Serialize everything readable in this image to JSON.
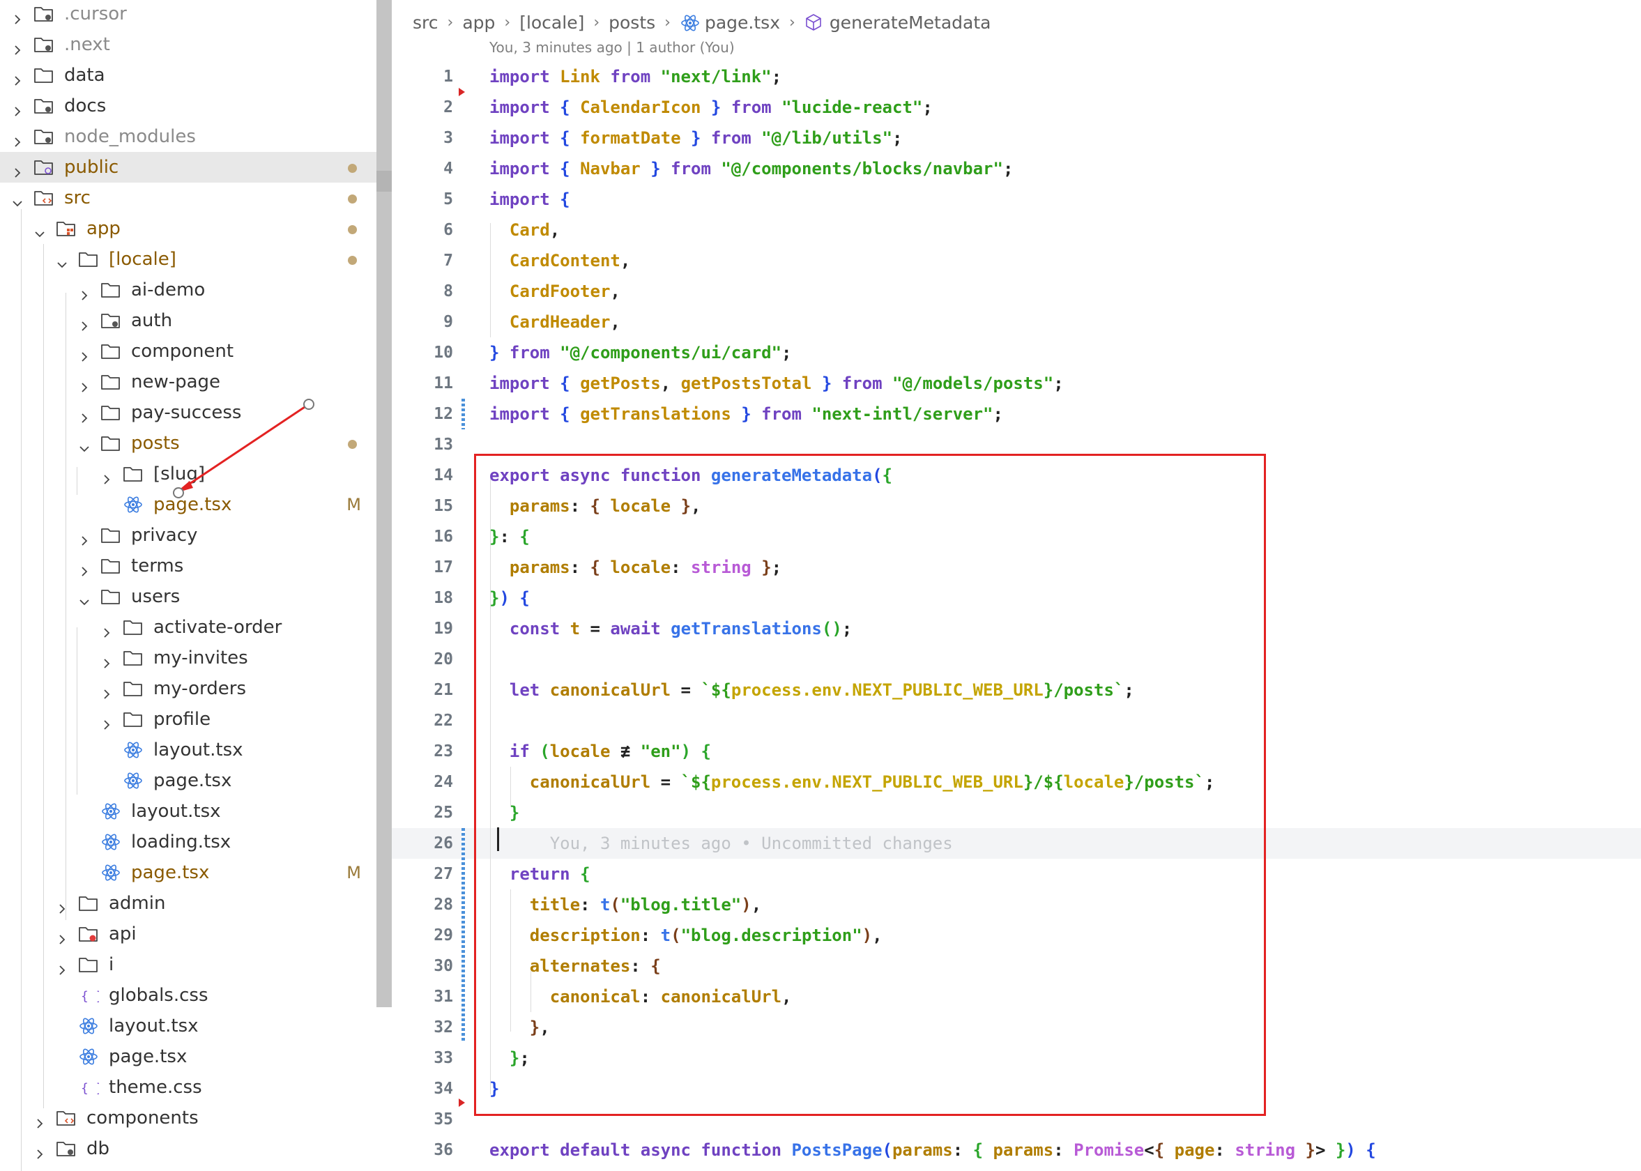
{
  "explorer": {
    "items": [
      {
        "label": "cursor_dir",
        "text": ".cursor",
        "muted": true,
        "depth": 0,
        "expanded": false,
        "type": "folder-special"
      },
      {
        "text": ".next",
        "muted": true,
        "depth": 0,
        "expanded": false,
        "type": "folder-special"
      },
      {
        "text": "data",
        "depth": 0,
        "expanded": false,
        "type": "folder"
      },
      {
        "text": "docs",
        "depth": 0,
        "expanded": false,
        "type": "folder-special"
      },
      {
        "text": "node_modules",
        "muted": true,
        "depth": 0,
        "expanded": false,
        "type": "folder-special"
      },
      {
        "text": "public",
        "depth": 0,
        "expanded": false,
        "type": "folder-public",
        "selected": true,
        "dot": true,
        "color": "#8a5a00"
      },
      {
        "text": "src",
        "depth": 0,
        "expanded": true,
        "type": "folder-src",
        "dot": true,
        "color": "#8a5a00"
      },
      {
        "text": "app",
        "depth": 1,
        "expanded": true,
        "type": "folder-app",
        "dot": true,
        "color": "#8a5a00"
      },
      {
        "text": "[locale]",
        "depth": 2,
        "expanded": true,
        "type": "folder",
        "dot": true,
        "color": "#8a5a00"
      },
      {
        "text": "ai-demo",
        "depth": 3,
        "expanded": false,
        "type": "folder"
      },
      {
        "text": "auth",
        "depth": 3,
        "expanded": false,
        "type": "folder-special"
      },
      {
        "text": "component",
        "depth": 3,
        "expanded": false,
        "type": "folder"
      },
      {
        "text": "new-page",
        "depth": 3,
        "expanded": false,
        "type": "folder"
      },
      {
        "text": "pay-success",
        "depth": 3,
        "expanded": false,
        "type": "folder"
      },
      {
        "text": "posts",
        "depth": 3,
        "expanded": true,
        "type": "folder",
        "dot": true,
        "color": "#8a5a00"
      },
      {
        "text": "[slug]",
        "depth": 4,
        "expanded": false,
        "type": "folder"
      },
      {
        "text": "page.tsx",
        "depth": 4,
        "type": "react",
        "status": "M",
        "color": "#8a5a00"
      },
      {
        "text": "privacy",
        "depth": 3,
        "expanded": false,
        "type": "folder"
      },
      {
        "text": "terms",
        "depth": 3,
        "expanded": false,
        "type": "folder"
      },
      {
        "text": "users",
        "depth": 3,
        "expanded": true,
        "type": "folder"
      },
      {
        "text": "activate-order",
        "depth": 4,
        "expanded": false,
        "type": "folder"
      },
      {
        "text": "my-invites",
        "depth": 4,
        "expanded": false,
        "type": "folder"
      },
      {
        "text": "my-orders",
        "depth": 4,
        "expanded": false,
        "type": "folder"
      },
      {
        "text": "profile",
        "depth": 4,
        "expanded": false,
        "type": "folder"
      },
      {
        "text": "layout.tsx",
        "depth": 4,
        "type": "react"
      },
      {
        "text": "page.tsx",
        "depth": 4,
        "type": "react"
      },
      {
        "text": "layout.tsx",
        "depth": 3,
        "type": "react"
      },
      {
        "text": "loading.tsx",
        "depth": 3,
        "type": "react"
      },
      {
        "text": "page.tsx",
        "depth": 3,
        "type": "react",
        "status": "M",
        "color": "#8a5a00"
      },
      {
        "text": "admin",
        "depth": 2,
        "expanded": false,
        "type": "folder"
      },
      {
        "text": "api",
        "depth": 2,
        "expanded": false,
        "type": "folder-api"
      },
      {
        "text": "i",
        "depth": 2,
        "expanded": false,
        "type": "folder"
      },
      {
        "text": "globals.css",
        "depth": 2,
        "type": "css"
      },
      {
        "text": "layout.tsx",
        "depth": 2,
        "type": "react"
      },
      {
        "text": "page.tsx",
        "depth": 2,
        "type": "react"
      },
      {
        "text": "theme.css",
        "depth": 2,
        "type": "css"
      },
      {
        "text": "components",
        "depth": 1,
        "expanded": false,
        "type": "folder-src"
      },
      {
        "text": "db",
        "depth": 1,
        "expanded": false,
        "type": "folder-special"
      }
    ]
  },
  "editor": {
    "breadcrumb": [
      "src",
      "app",
      "[locale]",
      "posts",
      "page.tsx",
      "generateMetadata"
    ],
    "blame_header": "You, 3 minutes ago | 1 author (You)",
    "inline_blame": "You, 3 minutes ago • Uncommitted changes",
    "lines": [
      [
        [
          "kw",
          "import "
        ],
        [
          "im",
          "Link "
        ],
        [
          "kw",
          "from "
        ],
        [
          "st",
          "\"next/link\""
        ],
        [
          "pl",
          ";"
        ]
      ],
      [
        [
          "kw",
          "import "
        ],
        [
          "br1",
          "{ "
        ],
        [
          "im",
          "CalendarIcon "
        ],
        [
          "br1",
          "} "
        ],
        [
          "kw",
          "from "
        ],
        [
          "st",
          "\"lucide-react\""
        ],
        [
          "pl",
          ";"
        ]
      ],
      [
        [
          "kw",
          "import "
        ],
        [
          "br1",
          "{ "
        ],
        [
          "im",
          "formatDate "
        ],
        [
          "br1",
          "} "
        ],
        [
          "kw",
          "from "
        ],
        [
          "st",
          "\"@/lib/utils\""
        ],
        [
          "pl",
          ";"
        ]
      ],
      [
        [
          "kw",
          "import "
        ],
        [
          "br1",
          "{ "
        ],
        [
          "im",
          "Navbar "
        ],
        [
          "br1",
          "} "
        ],
        [
          "kw",
          "from "
        ],
        [
          "st",
          "\"@/components/blocks/navbar\""
        ],
        [
          "pl",
          ";"
        ]
      ],
      [
        [
          "kw",
          "import "
        ],
        [
          "br1",
          "{"
        ]
      ],
      [
        [
          "pl",
          "  "
        ],
        [
          "im",
          "Card"
        ],
        [
          "pl",
          ","
        ]
      ],
      [
        [
          "pl",
          "  "
        ],
        [
          "im",
          "CardContent"
        ],
        [
          "pl",
          ","
        ]
      ],
      [
        [
          "pl",
          "  "
        ],
        [
          "im",
          "CardFooter"
        ],
        [
          "pl",
          ","
        ]
      ],
      [
        [
          "pl",
          "  "
        ],
        [
          "im",
          "CardHeader"
        ],
        [
          "pl",
          ","
        ]
      ],
      [
        [
          "br1",
          "} "
        ],
        [
          "kw",
          "from "
        ],
        [
          "st",
          "\"@/components/ui/card\""
        ],
        [
          "pl",
          ";"
        ]
      ],
      [
        [
          "kw",
          "import "
        ],
        [
          "br1",
          "{ "
        ],
        [
          "im",
          "getPosts"
        ],
        [
          "pl",
          ", "
        ],
        [
          "im",
          "getPostsTotal "
        ],
        [
          "br1",
          "} "
        ],
        [
          "kw",
          "from "
        ],
        [
          "st",
          "\"@/models/posts\""
        ],
        [
          "pl",
          ";"
        ]
      ],
      [
        [
          "kw",
          "import "
        ],
        [
          "br1",
          "{ "
        ],
        [
          "im",
          "getTranslations "
        ],
        [
          "br1",
          "} "
        ],
        [
          "kw",
          "from "
        ],
        [
          "st",
          "\"next-intl/server\""
        ],
        [
          "pl",
          ";"
        ]
      ],
      [],
      [
        [
          "kw",
          "export async function "
        ],
        [
          "fn",
          "generateMetadata"
        ],
        [
          "br1",
          "("
        ],
        [
          "br2",
          "{"
        ]
      ],
      [
        [
          "pl",
          "  "
        ],
        [
          "id",
          "params"
        ],
        [
          "pl",
          ": "
        ],
        [
          "br3",
          "{ "
        ],
        [
          "id",
          "locale "
        ],
        [
          "br3",
          "}"
        ],
        [
          "pl",
          ","
        ]
      ],
      [
        [
          "br2",
          "}"
        ],
        [
          "pl",
          ": "
        ],
        [
          "br2",
          "{"
        ]
      ],
      [
        [
          "pl",
          "  "
        ],
        [
          "id",
          "params"
        ],
        [
          "pl",
          ": "
        ],
        [
          "br3",
          "{ "
        ],
        [
          "id",
          "locale"
        ],
        [
          "pl",
          ": "
        ],
        [
          "ty",
          "string "
        ],
        [
          "br3",
          "}"
        ],
        [
          "pl",
          ";"
        ]
      ],
      [
        [
          "br2",
          "}"
        ],
        [
          "br1",
          ") "
        ],
        [
          "br1",
          "{"
        ]
      ],
      [
        [
          "pl",
          "  "
        ],
        [
          "kw",
          "const "
        ],
        [
          "id",
          "t "
        ],
        [
          "op",
          "= "
        ],
        [
          "kw",
          "await "
        ],
        [
          "fn",
          "getTranslations"
        ],
        [
          "br2",
          "()"
        ],
        [
          "pl",
          ";"
        ]
      ],
      [],
      [
        [
          "pl",
          "  "
        ],
        [
          "kw",
          "let "
        ],
        [
          "id",
          "canonicalUrl "
        ],
        [
          "op",
          "= "
        ],
        [
          "st",
          "`${"
        ],
        [
          "tp",
          "process.env.NEXT_PUBLIC_WEB_URL"
        ],
        [
          "st",
          "}/posts`"
        ],
        [
          "pl",
          ";"
        ]
      ],
      [],
      [
        [
          "pl",
          "  "
        ],
        [
          "kw",
          "if "
        ],
        [
          "br2",
          "("
        ],
        [
          "id",
          "locale "
        ],
        [
          "op",
          "≢ "
        ],
        [
          "st",
          "\"en\""
        ],
        [
          "br2",
          ") "
        ],
        [
          "br2",
          "{"
        ]
      ],
      [
        [
          "pl",
          "    "
        ],
        [
          "id",
          "canonicalUrl "
        ],
        [
          "op",
          "= "
        ],
        [
          "st",
          "`${"
        ],
        [
          "tp",
          "process.env.NEXT_PUBLIC_WEB_URL"
        ],
        [
          "st",
          "}/${"
        ],
        [
          "tp",
          "locale"
        ],
        [
          "st",
          "}/posts`"
        ],
        [
          "pl",
          ";"
        ]
      ],
      [
        [
          "pl",
          "  "
        ],
        [
          "br2",
          "}"
        ]
      ],
      [
        [
          "ghost",
          "      You, 3 minutes ago • Uncommitted changes"
        ]
      ],
      [
        [
          "pl",
          "  "
        ],
        [
          "kw",
          "return "
        ],
        [
          "br2",
          "{"
        ]
      ],
      [
        [
          "pl",
          "    "
        ],
        [
          "id",
          "title"
        ],
        [
          "pl",
          ": "
        ],
        [
          "fn",
          "t"
        ],
        [
          "br3",
          "("
        ],
        [
          "st",
          "\"blog.title\""
        ],
        [
          "br3",
          ")"
        ],
        [
          "pl",
          ","
        ]
      ],
      [
        [
          "pl",
          "    "
        ],
        [
          "id",
          "description"
        ],
        [
          "pl",
          ": "
        ],
        [
          "fn",
          "t"
        ],
        [
          "br3",
          "("
        ],
        [
          "st",
          "\"blog.description\""
        ],
        [
          "br3",
          ")"
        ],
        [
          "pl",
          ","
        ]
      ],
      [
        [
          "pl",
          "    "
        ],
        [
          "id",
          "alternates"
        ],
        [
          "pl",
          ": "
        ],
        [
          "br3",
          "{"
        ]
      ],
      [
        [
          "pl",
          "      "
        ],
        [
          "id",
          "canonical"
        ],
        [
          "pl",
          ": "
        ],
        [
          "id",
          "canonicalUrl"
        ],
        [
          "pl",
          ","
        ]
      ],
      [
        [
          "pl",
          "    "
        ],
        [
          "br3",
          "}"
        ],
        [
          "pl",
          ","
        ]
      ],
      [
        [
          "pl",
          "  "
        ],
        [
          "br2",
          "}"
        ],
        [
          "pl",
          ";"
        ]
      ],
      [
        [
          "br1",
          "}"
        ]
      ],
      [],
      [
        [
          "kw",
          "export default async function "
        ],
        [
          "fn",
          "PostsPage"
        ],
        [
          "br1",
          "("
        ],
        [
          "id",
          "params"
        ],
        [
          "pl",
          ": "
        ],
        [
          "br2",
          "{ "
        ],
        [
          "id",
          "params"
        ],
        [
          "pl",
          ": "
        ],
        [
          "ty",
          "Promise"
        ],
        [
          "pl",
          "<"
        ],
        [
          "br3",
          "{ "
        ],
        [
          "id",
          "page"
        ],
        [
          "pl",
          ": "
        ],
        [
          "ty",
          "string "
        ],
        [
          "br3",
          "}"
        ],
        [
          "pl",
          "> "
        ],
        [
          "br2",
          "}"
        ],
        [
          "br1",
          ") "
        ],
        [
          "br1",
          "{"
        ]
      ]
    ]
  },
  "colors": {
    "accent_modified": "#8a5a00",
    "highlight_box": "#e32222",
    "git_added": "#4a90d9"
  }
}
